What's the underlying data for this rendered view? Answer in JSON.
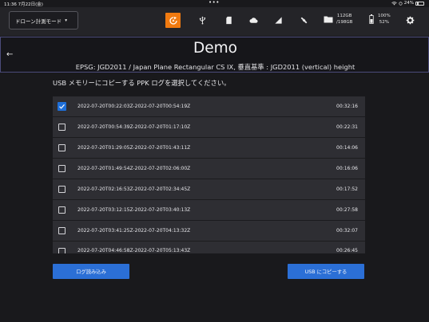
{
  "status_bar": {
    "time_date": "11:36  7月22日(金)",
    "dots": "•••",
    "battery_text": "24%"
  },
  "toolbar": {
    "mode_label": "ドローン計測モード",
    "mode_caret": "▾",
    "storage_line1": "112GB",
    "storage_line2": "/198GB",
    "battery_line1": "100%",
    "battery_line2": "52%",
    "accent_color": "#f07a10",
    "icons": [
      "rtk-icon",
      "usb-icon",
      "sd-card-icon",
      "cloud-icon",
      "signal-icon",
      "satellite-icon",
      "folder-icon",
      "battery-icon",
      "gear-icon"
    ]
  },
  "header": {
    "back_icon": "←",
    "title": "Demo",
    "subtitle": "EPSG: JGD2011 / Japan Plane Rectangular CS IX, 垂直基準 : JGD2011 (vertical) height"
  },
  "instruction": "USB メモリーにコピーする PPK ログを選択してください。",
  "logs": [
    {
      "name": "2022-07-20T00:22:03Z-2022-07-20T00:54:19Z",
      "duration": "00:32:16",
      "checked": true
    },
    {
      "name": "2022-07-20T00:54:39Z-2022-07-20T01:17:10Z",
      "duration": "00:22:31",
      "checked": false
    },
    {
      "name": "2022-07-20T01:29:05Z-2022-07-20T01:43:11Z",
      "duration": "00:14:06",
      "checked": false
    },
    {
      "name": "2022-07-20T01:49:54Z-2022-07-20T02:06:00Z",
      "duration": "00:16:06",
      "checked": false
    },
    {
      "name": "2022-07-20T02:16:53Z-2022-07-20T02:34:45Z",
      "duration": "00:17:52",
      "checked": false
    },
    {
      "name": "2022-07-20T03:12:15Z-2022-07-20T03:40:13Z",
      "duration": "00:27:58",
      "checked": false
    },
    {
      "name": "2022-07-20T03:41:25Z-2022-07-20T04:13:32Z",
      "duration": "00:32:07",
      "checked": false
    },
    {
      "name": "2022-07-20T04:46:58Z-2022-07-20T05:13:43Z",
      "duration": "00:26:45",
      "checked": false
    }
  ],
  "buttons": {
    "load_logs": "ログ読み込み",
    "copy_usb": "USB にコピーする",
    "button_color": "#2b6fd6"
  }
}
